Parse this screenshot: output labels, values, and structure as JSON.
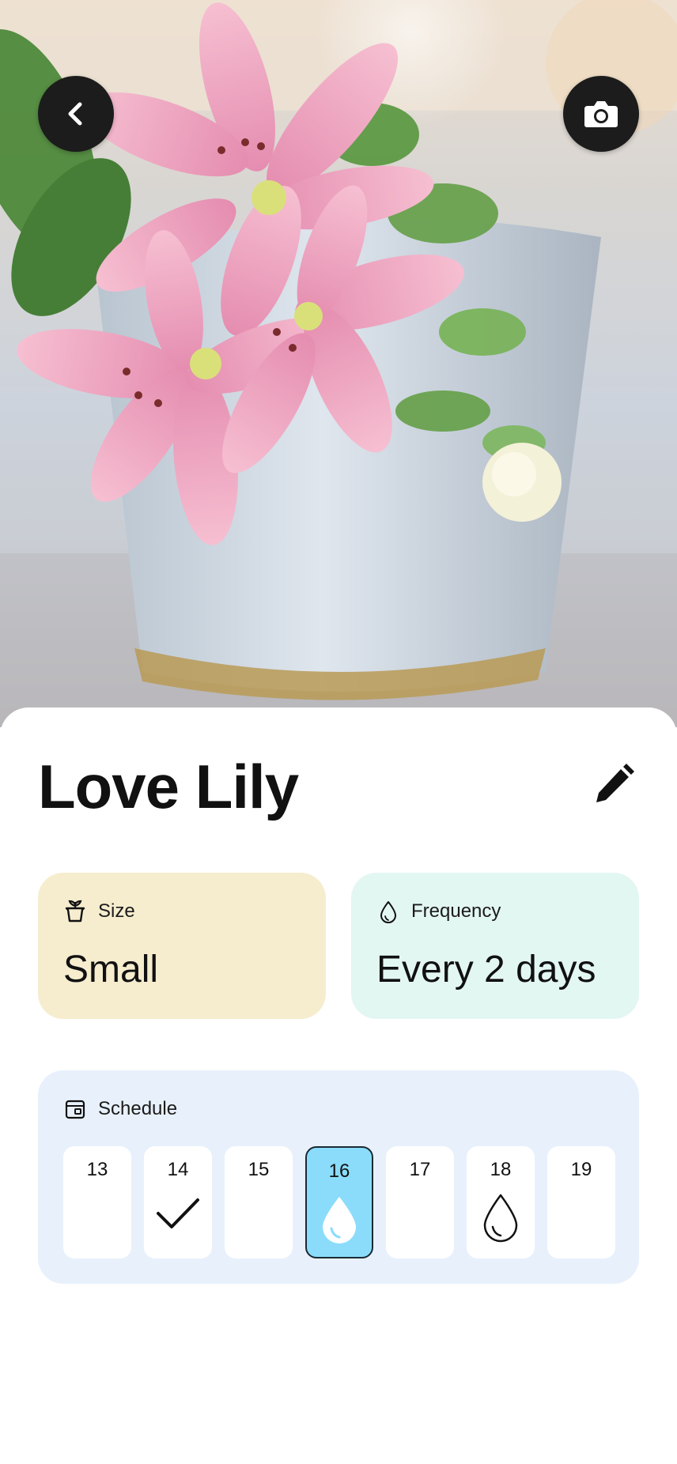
{
  "plant": {
    "name": "Love Lily"
  },
  "hero": {
    "image_icon": "lily-photo"
  },
  "buttons": {
    "back_icon": "chevron-left-icon",
    "camera_icon": "camera-icon",
    "edit_icon": "pencil-icon"
  },
  "size": {
    "label": "Size",
    "value": "Small",
    "icon": "plant-pot-icon"
  },
  "frequency": {
    "label": "Frequency",
    "value": "Every 2 days",
    "icon": "water-drop-icon"
  },
  "schedule": {
    "label": "Schedule",
    "icon": "calendar-icon",
    "days": [
      {
        "num": "13",
        "status": "none"
      },
      {
        "num": "14",
        "status": "done"
      },
      {
        "num": "15",
        "status": "none"
      },
      {
        "num": "16",
        "status": "today-water"
      },
      {
        "num": "17",
        "status": "none"
      },
      {
        "num": "18",
        "status": "planned-water"
      },
      {
        "num": "19",
        "status": "none"
      }
    ]
  },
  "colors": {
    "size_card": "#f6edcf",
    "frequency_card": "#e3f7f2",
    "schedule_card": "#e8f1fb",
    "active_day": "#8bdcfb"
  }
}
